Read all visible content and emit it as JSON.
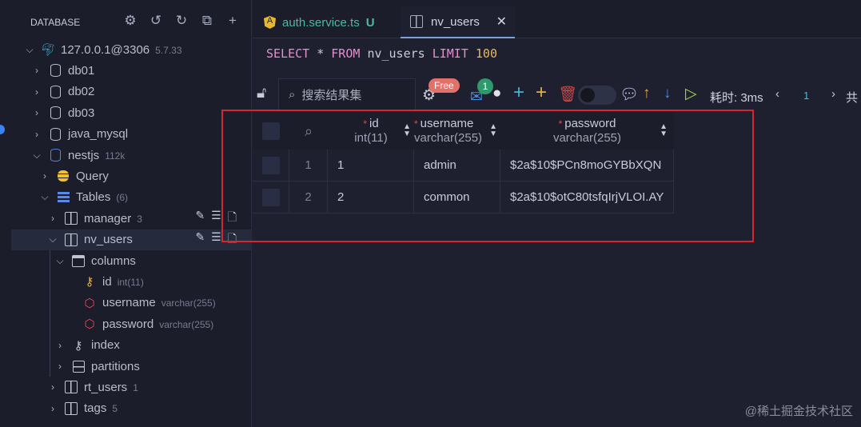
{
  "sidebar": {
    "title": "DATABASE",
    "tree": [
      {
        "level": 0,
        "chev": "down",
        "icon": "mysql-icon",
        "label": "127.0.0.1@3306",
        "meta": "5.7.33"
      },
      {
        "level": 1,
        "chev": "right",
        "icon": "database-icon",
        "label": "db01"
      },
      {
        "level": 1,
        "chev": "right",
        "icon": "database-icon",
        "label": "db02"
      },
      {
        "level": 1,
        "chev": "right",
        "icon": "database-icon",
        "label": "db03"
      },
      {
        "level": 1,
        "chev": "right",
        "icon": "database-icon",
        "label": "java_mysql"
      },
      {
        "level": 1,
        "chev": "down",
        "icon": "database-active-icon",
        "label": "nestjs",
        "meta": "112k"
      },
      {
        "level": 2,
        "chev": "right",
        "icon": "query-icon",
        "label": "Query"
      },
      {
        "level": 2,
        "chev": "down",
        "icon": "tables-icon",
        "label": "Tables",
        "meta": "(6)"
      },
      {
        "level": 3,
        "chev": "right",
        "icon": "table-icon",
        "label": "manager",
        "meta": "3",
        "actions": true
      },
      {
        "level": 3,
        "chev": "down",
        "icon": "table-icon",
        "label": "nv_users",
        "actions": true,
        "selected": true
      },
      {
        "level": 4,
        "chev": "down",
        "icon": "columns-icon",
        "label": "columns"
      },
      {
        "level": 5,
        "icon": "key-icon",
        "label": "id",
        "meta": "int(11)"
      },
      {
        "level": 5,
        "icon": "column-icon",
        "label": "username",
        "meta": "varchar(255)"
      },
      {
        "level": 5,
        "icon": "column-icon",
        "label": "password",
        "meta": "varchar(255)"
      },
      {
        "level": 4,
        "chev": "right",
        "icon": "index-key-icon",
        "label": "index"
      },
      {
        "level": 4,
        "chev": "right",
        "icon": "partitions-icon",
        "label": "partitions"
      },
      {
        "level": 3,
        "chev": "right",
        "icon": "table-icon",
        "label": "rt_users",
        "meta": "1"
      },
      {
        "level": 3,
        "chev": "right",
        "icon": "table-icon",
        "label": "tags",
        "meta": "5"
      }
    ]
  },
  "tabs": [
    {
      "label": "auth.service.ts",
      "status": "U"
    },
    {
      "label": "nv_users"
    }
  ],
  "editor": {
    "kw1": "SELECT",
    "star": "*",
    "kw2": "FROM",
    "table": "nv_users",
    "kw3": "LIMIT",
    "limit": "100"
  },
  "toolbar": {
    "search_placeholder": "搜索结果集",
    "free_badge": "Free",
    "notify_count": "1",
    "time": "耗时: 3ms",
    "page": "1",
    "total_prefix": "共"
  },
  "grid": {
    "columns": [
      {
        "name": "id",
        "type": "int(11)"
      },
      {
        "name": "username",
        "type": "varchar(255)"
      },
      {
        "name": "password",
        "type": "varchar(255)"
      }
    ],
    "rows": [
      [
        "1",
        "1",
        "admin",
        "$2a$10$PCn8moGYBbXQN"
      ],
      [
        "2",
        "2",
        "common",
        "$2a$10$otC80tsfqIrjVLOI.AY"
      ]
    ]
  },
  "watermark": "@稀土掘金技术社区"
}
